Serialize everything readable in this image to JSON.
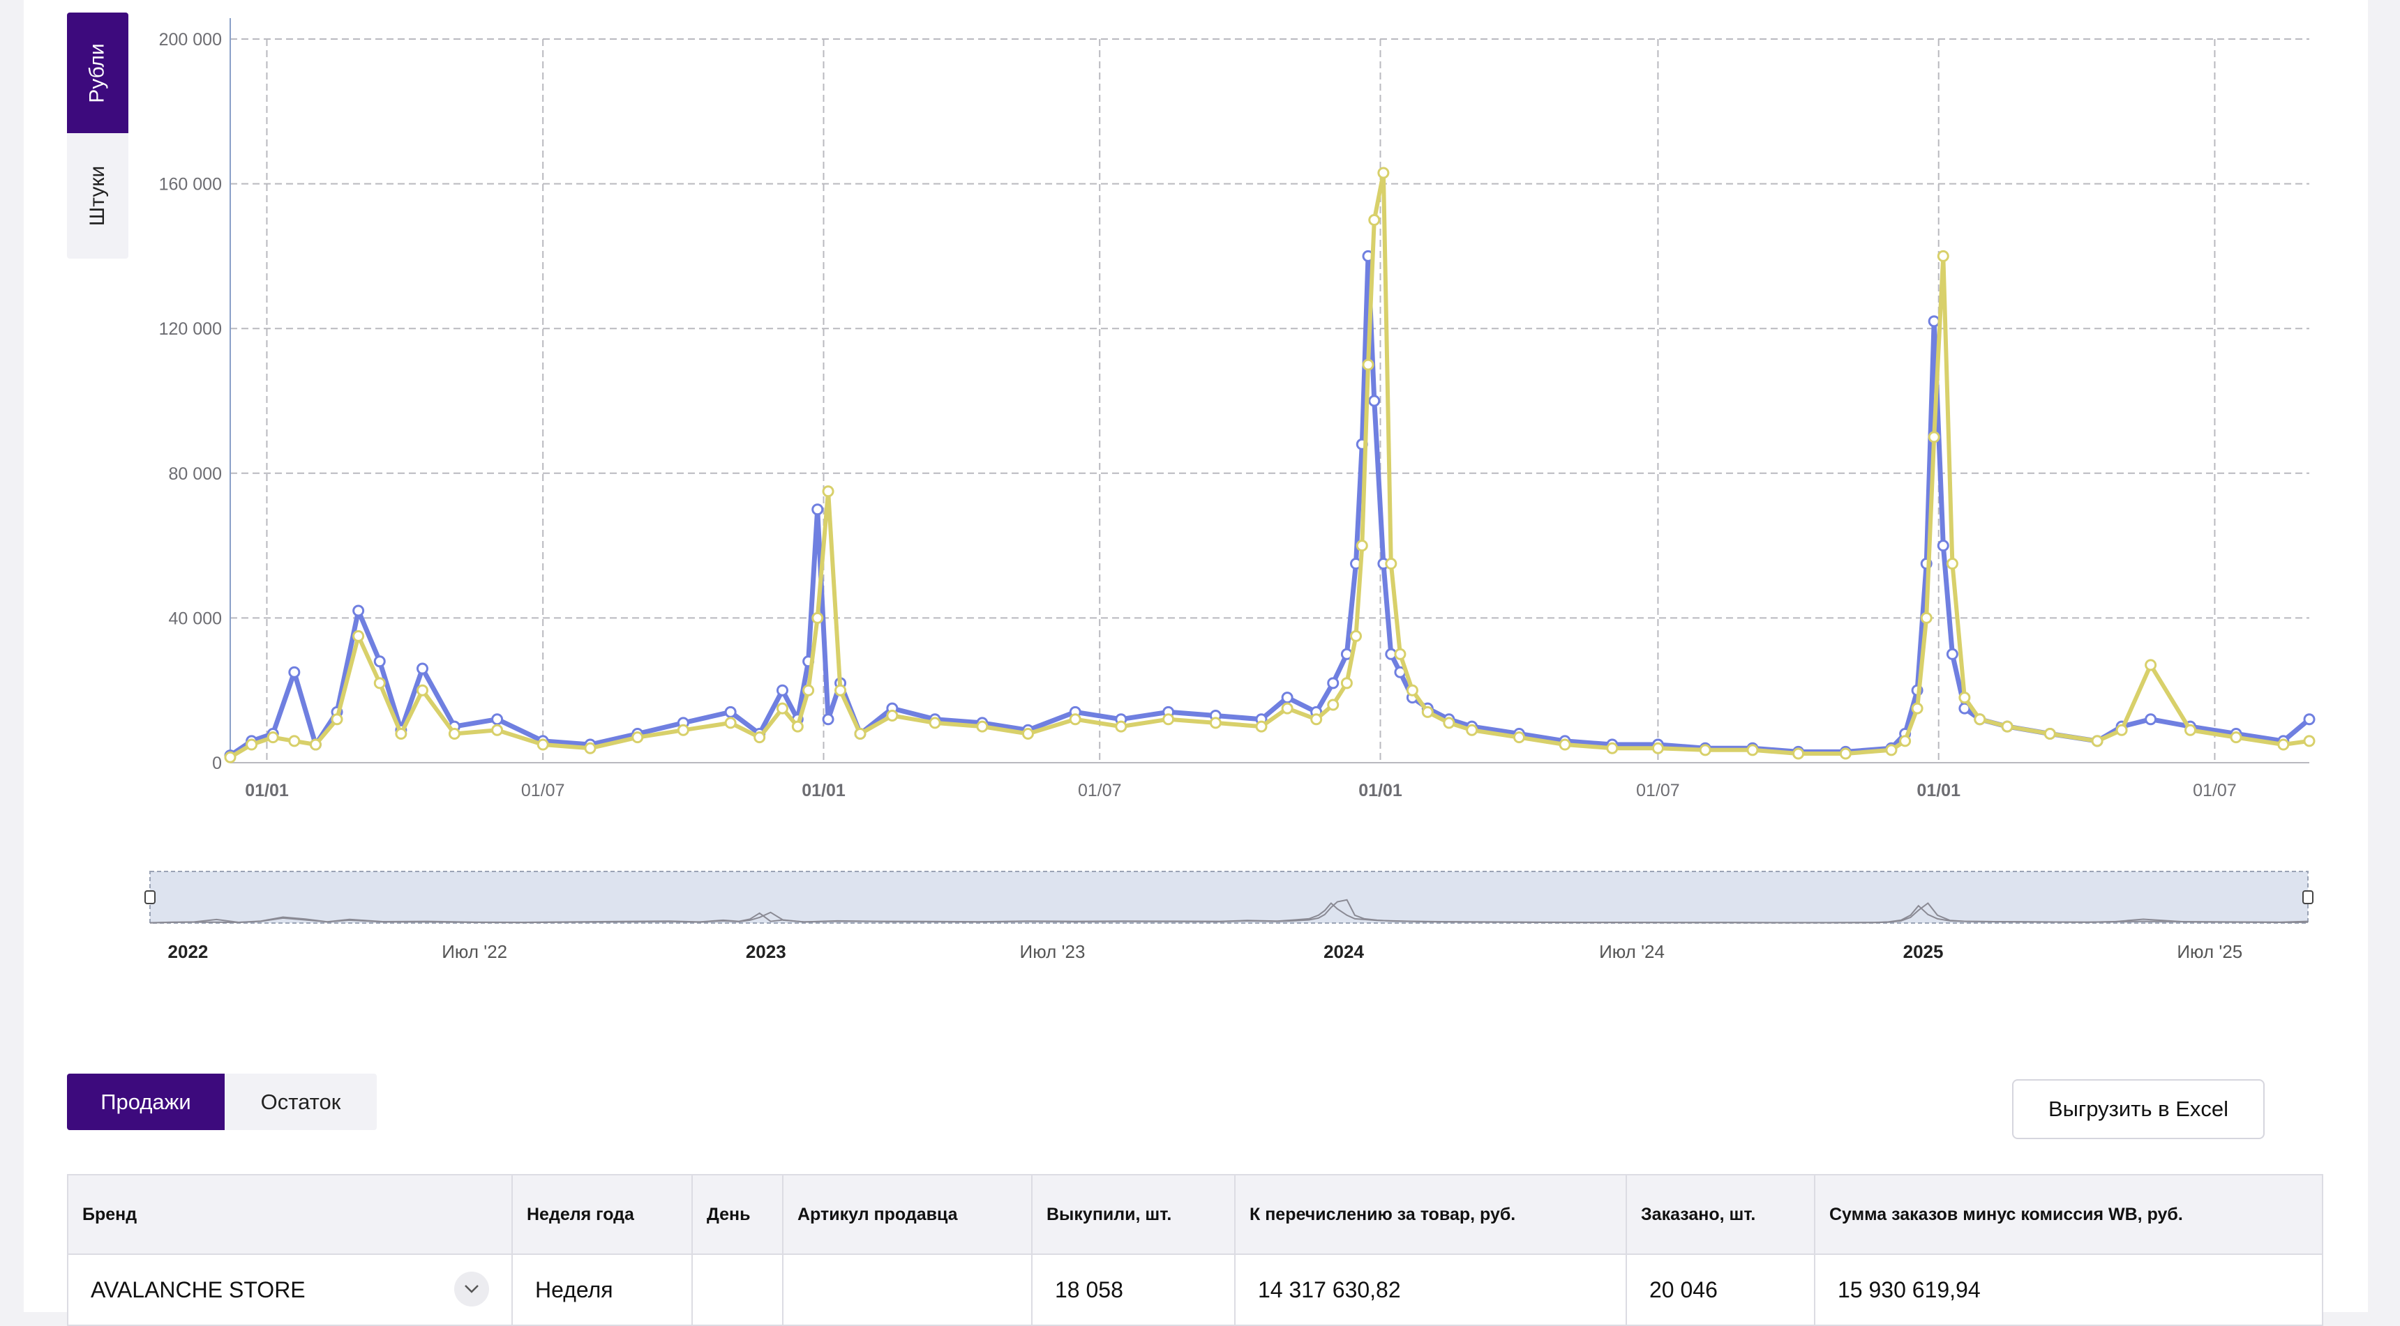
{
  "toggle": {
    "rubles": "Рубли",
    "units": "Штуки"
  },
  "colors": {
    "accent": "#3d0a7d",
    "series1": "#6f7fe0",
    "series2": "#d8d06a",
    "navigator": "#dde3ef"
  },
  "chart_data": {
    "type": "line",
    "xlim": [
      "2021-12-08",
      "2025-09-01"
    ],
    "ylim": [
      0,
      200000
    ],
    "y_ticks": [
      "0",
      "40 000",
      "80 000",
      "120 000",
      "160 000",
      "200 000"
    ],
    "y_tick_values": [
      0,
      40000,
      80000,
      120000,
      160000,
      200000
    ],
    "x_ticks": [
      {
        "date": "2022-01-01",
        "label": "01/01",
        "bold": true
      },
      {
        "date": "2022-07-01",
        "label": "01/07",
        "bold": false
      },
      {
        "date": "2023-01-01",
        "label": "01/01",
        "bold": true
      },
      {
        "date": "2023-07-01",
        "label": "01/07",
        "bold": false
      },
      {
        "date": "2024-01-01",
        "label": "01/01",
        "bold": true
      },
      {
        "date": "2024-07-01",
        "label": "01/07",
        "bold": false
      },
      {
        "date": "2025-01-01",
        "label": "01/01",
        "bold": true
      },
      {
        "date": "2025-07-01",
        "label": "01/07",
        "bold": false
      }
    ],
    "grid": true,
    "series": [
      {
        "color": "#6f7fe0",
        "x": [
          "2021-12-08",
          "2021-12-22",
          "2022-01-05",
          "2022-01-19",
          "2022-02-02",
          "2022-02-16",
          "2022-03-02",
          "2022-03-16",
          "2022-03-30",
          "2022-04-13",
          "2022-05-04",
          "2022-06-01",
          "2022-07-01",
          "2022-08-01",
          "2022-09-01",
          "2022-10-01",
          "2022-11-01",
          "2022-11-20",
          "2022-12-05",
          "2022-12-15",
          "2022-12-22",
          "2022-12-28",
          "2023-01-04",
          "2023-01-12",
          "2023-01-25",
          "2023-02-15",
          "2023-03-15",
          "2023-04-15",
          "2023-05-15",
          "2023-06-15",
          "2023-07-15",
          "2023-08-15",
          "2023-09-15",
          "2023-10-15",
          "2023-11-01",
          "2023-11-20",
          "2023-12-01",
          "2023-12-10",
          "2023-12-16",
          "2023-12-20",
          "2023-12-24",
          "2023-12-28",
          "2024-01-03",
          "2024-01-08",
          "2024-01-14",
          "2024-01-22",
          "2024-02-01",
          "2024-02-15",
          "2024-03-01",
          "2024-04-01",
          "2024-05-01",
          "2024-06-01",
          "2024-07-01",
          "2024-08-01",
          "2024-09-01",
          "2024-10-01",
          "2024-11-01",
          "2024-12-01",
          "2024-12-10",
          "2024-12-18",
          "2024-12-24",
          "2024-12-29",
          "2025-01-04",
          "2025-01-10",
          "2025-01-18",
          "2025-01-28",
          "2025-02-15",
          "2025-03-15",
          "2025-04-15",
          "2025-05-01",
          "2025-05-20",
          "2025-06-15",
          "2025-07-15",
          "2025-08-15",
          "2025-09-01"
        ],
        "y": [
          2000,
          6000,
          8000,
          25000,
          5000,
          14000,
          42000,
          28000,
          9000,
          26000,
          10000,
          12000,
          6000,
          5000,
          8000,
          11000,
          14000,
          8000,
          20000,
          12000,
          28000,
          70000,
          12000,
          22000,
          8000,
          15000,
          12000,
          11000,
          9000,
          14000,
          12000,
          14000,
          13000,
          12000,
          18000,
          14000,
          22000,
          30000,
          55000,
          88000,
          140000,
          100000,
          55000,
          30000,
          25000,
          18000,
          15000,
          12000,
          10000,
          8000,
          6000,
          5000,
          5000,
          4000,
          4000,
          3000,
          3000,
          4000,
          8000,
          20000,
          55000,
          122000,
          60000,
          30000,
          15000,
          12000,
          10000,
          8000,
          6000,
          10000,
          12000,
          10000,
          8000,
          6000,
          12000
        ]
      },
      {
        "color": "#d8d06a",
        "x": [
          "2021-12-08",
          "2021-12-22",
          "2022-01-05",
          "2022-01-19",
          "2022-02-02",
          "2022-02-16",
          "2022-03-02",
          "2022-03-16",
          "2022-03-30",
          "2022-04-13",
          "2022-05-04",
          "2022-06-01",
          "2022-07-01",
          "2022-08-01",
          "2022-09-01",
          "2022-10-01",
          "2022-11-01",
          "2022-11-20",
          "2022-12-05",
          "2022-12-15",
          "2022-12-22",
          "2022-12-28",
          "2023-01-04",
          "2023-01-12",
          "2023-01-25",
          "2023-02-15",
          "2023-03-15",
          "2023-04-15",
          "2023-05-15",
          "2023-06-15",
          "2023-07-15",
          "2023-08-15",
          "2023-09-15",
          "2023-10-15",
          "2023-11-01",
          "2023-11-20",
          "2023-12-01",
          "2023-12-10",
          "2023-12-16",
          "2023-12-20",
          "2023-12-24",
          "2023-12-28",
          "2024-01-03",
          "2024-01-08",
          "2024-01-14",
          "2024-01-22",
          "2024-02-01",
          "2024-02-15",
          "2024-03-01",
          "2024-04-01",
          "2024-05-01",
          "2024-06-01",
          "2024-07-01",
          "2024-08-01",
          "2024-09-01",
          "2024-10-01",
          "2024-11-01",
          "2024-12-01",
          "2024-12-10",
          "2024-12-18",
          "2024-12-24",
          "2024-12-29",
          "2025-01-04",
          "2025-01-10",
          "2025-01-18",
          "2025-01-28",
          "2025-02-15",
          "2025-03-15",
          "2025-04-15",
          "2025-05-01",
          "2025-05-20",
          "2025-06-15",
          "2025-07-15",
          "2025-08-15",
          "2025-09-01"
        ],
        "y": [
          1500,
          5000,
          7000,
          6000,
          5000,
          12000,
          35000,
          22000,
          8000,
          20000,
          8000,
          9000,
          5000,
          4000,
          7000,
          9000,
          11000,
          7000,
          15000,
          10000,
          20000,
          40000,
          75000,
          20000,
          8000,
          13000,
          11000,
          10000,
          8000,
          12000,
          10000,
          12000,
          11000,
          10000,
          15000,
          12000,
          16000,
          22000,
          35000,
          60000,
          110000,
          150000,
          163000,
          55000,
          30000,
          20000,
          14000,
          11000,
          9000,
          7000,
          5000,
          4000,
          4000,
          3500,
          3500,
          2500,
          2500,
          3500,
          6000,
          15000,
          40000,
          90000,
          140000,
          55000,
          18000,
          12000,
          10000,
          8000,
          6000,
          9000,
          27000,
          9000,
          7000,
          5000,
          6000
        ]
      }
    ]
  },
  "navigator": {
    "labels": [
      {
        "date": "2022-01-01",
        "text": "2022",
        "bold": true
      },
      {
        "date": "2022-07-01",
        "text": "Июл '22",
        "bold": false
      },
      {
        "date": "2023-01-01",
        "text": "2023",
        "bold": true
      },
      {
        "date": "2023-07-01",
        "text": "Июл '23",
        "bold": false
      },
      {
        "date": "2024-01-01",
        "text": "2024",
        "bold": true
      },
      {
        "date": "2024-07-01",
        "text": "Июл '24",
        "bold": false
      },
      {
        "date": "2025-01-01",
        "text": "2025",
        "bold": true
      },
      {
        "date": "2025-07-01",
        "text": "Июл '25",
        "bold": false
      }
    ]
  },
  "tabs": {
    "sales": "Продажи",
    "stock": "Остаток"
  },
  "export_button": "Выгрузить в Excel",
  "table": {
    "headers": [
      "Бренд",
      "Неделя года",
      "День",
      "Артикул продавца",
      "Выкупили, шт.",
      "К перечислению за товар, руб.",
      "Заказано, шт.",
      "Сумма заказов минус комиссия WB, руб."
    ],
    "row": {
      "brand": "AVALANCHE STORE",
      "week": "Неделя",
      "day": "",
      "article": "",
      "bought": "18 058",
      "payout": "14 317 630,82",
      "ordered": "20 046",
      "orders_sum": "15 930 619,94"
    }
  }
}
